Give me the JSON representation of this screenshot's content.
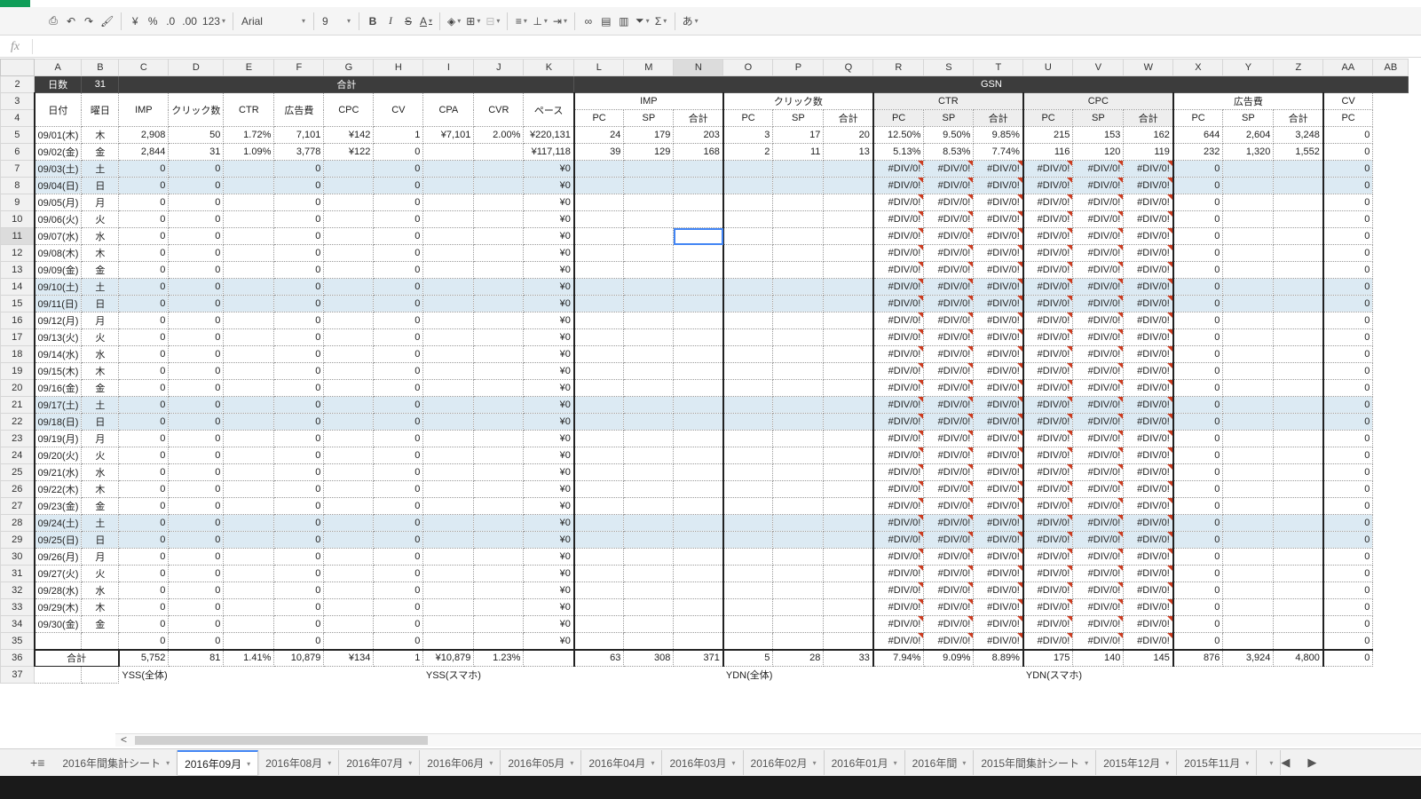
{
  "toolbar": {
    "currency_label": "¥",
    "percent_label": "%",
    "decimal_decrease_label": ".0",
    "decimal_increase_label": ".00",
    "more_formats_label": "123",
    "font_name": "Arial",
    "font_size": "9",
    "bold_label": "B",
    "italic_label": "I",
    "strike_label": "S",
    "text_color_label": "A",
    "input_tools_label": "あ"
  },
  "formula_bar": {
    "fx_label": "fx",
    "value": ""
  },
  "columns": [
    "A",
    "B",
    "C",
    "D",
    "E",
    "F",
    "G",
    "H",
    "I",
    "J",
    "K",
    "L",
    "M",
    "N",
    "O",
    "P",
    "Q",
    "R",
    "S",
    "T",
    "U",
    "V",
    "W",
    "X",
    "Y",
    "Z",
    "AA",
    "AB"
  ],
  "selected_column": "N",
  "selected_row": "11",
  "header": {
    "days_label": "日数",
    "days_value": "31",
    "total_group": "合計",
    "gsn_group": "GSN",
    "date_label": "日付",
    "weekday_label": "曜日",
    "total_cols": [
      "IMP",
      "クリック数",
      "CTR",
      "広告費",
      "CPC",
      "CV",
      "CPA",
      "CVR",
      "ペース"
    ],
    "gsn_groups": [
      "IMP",
      "クリック数",
      "CTR",
      "CPC",
      "広告費",
      "CV"
    ],
    "sub_cols": [
      "PC",
      "SP",
      "合計"
    ]
  },
  "rows": [
    {
      "r": "5",
      "date": "09/01(木)",
      "wd": "木",
      "we": false,
      "imp": "2,908",
      "clk": "50",
      "ctr": "1.72%",
      "cost": "7,101",
      "cpc": "¥142",
      "cv": "1",
      "cpa": "¥7,101",
      "cvr": "2.00%",
      "pace": "¥220,131",
      "g": [
        "24",
        "179",
        "203",
        "3",
        "17",
        "20",
        "12.50%",
        "9.50%",
        "9.85%",
        "215",
        "153",
        "162",
        "644",
        "2,604",
        "3,248",
        "0"
      ]
    },
    {
      "r": "6",
      "date": "09/02(金)",
      "wd": "金",
      "we": false,
      "imp": "2,844",
      "clk": "31",
      "ctr": "1.09%",
      "cost": "3,778",
      "cpc": "¥122",
      "cv": "0",
      "cpa": "",
      "cvr": "",
      "pace": "¥117,118",
      "g": [
        "39",
        "129",
        "168",
        "2",
        "11",
        "13",
        "5.13%",
        "8.53%",
        "7.74%",
        "116",
        "120",
        "119",
        "232",
        "1,320",
        "1,552",
        "0"
      ]
    },
    {
      "r": "7",
      "date": "09/03(土)",
      "wd": "土",
      "we": true
    },
    {
      "r": "8",
      "date": "09/04(日)",
      "wd": "日",
      "we": true
    },
    {
      "r": "9",
      "date": "09/05(月)",
      "wd": "月",
      "we": false
    },
    {
      "r": "10",
      "date": "09/06(火)",
      "wd": "火",
      "we": false
    },
    {
      "r": "11",
      "date": "09/07(水)",
      "wd": "水",
      "we": false
    },
    {
      "r": "12",
      "date": "09/08(木)",
      "wd": "木",
      "we": false
    },
    {
      "r": "13",
      "date": "09/09(金)",
      "wd": "金",
      "we": false
    },
    {
      "r": "14",
      "date": "09/10(土)",
      "wd": "土",
      "we": true
    },
    {
      "r": "15",
      "date": "09/11(日)",
      "wd": "日",
      "we": true
    },
    {
      "r": "16",
      "date": "09/12(月)",
      "wd": "月",
      "we": false
    },
    {
      "r": "17",
      "date": "09/13(火)",
      "wd": "火",
      "we": false
    },
    {
      "r": "18",
      "date": "09/14(水)",
      "wd": "水",
      "we": false
    },
    {
      "r": "19",
      "date": "09/15(木)",
      "wd": "木",
      "we": false
    },
    {
      "r": "20",
      "date": "09/16(金)",
      "wd": "金",
      "we": false
    },
    {
      "r": "21",
      "date": "09/17(土)",
      "wd": "土",
      "we": true
    },
    {
      "r": "22",
      "date": "09/18(日)",
      "wd": "日",
      "we": true
    },
    {
      "r": "23",
      "date": "09/19(月)",
      "wd": "月",
      "we": false
    },
    {
      "r": "24",
      "date": "09/20(火)",
      "wd": "火",
      "we": false
    },
    {
      "r": "25",
      "date": "09/21(水)",
      "wd": "水",
      "we": false
    },
    {
      "r": "26",
      "date": "09/22(木)",
      "wd": "木",
      "we": false
    },
    {
      "r": "27",
      "date": "09/23(金)",
      "wd": "金",
      "we": false
    },
    {
      "r": "28",
      "date": "09/24(土)",
      "wd": "土",
      "we": true
    },
    {
      "r": "29",
      "date": "09/25(日)",
      "wd": "日",
      "we": true
    },
    {
      "r": "30",
      "date": "09/26(月)",
      "wd": "月",
      "we": false
    },
    {
      "r": "31",
      "date": "09/27(火)",
      "wd": "火",
      "we": false
    },
    {
      "r": "32",
      "date": "09/28(水)",
      "wd": "水",
      "we": false
    },
    {
      "r": "33",
      "date": "09/29(木)",
      "wd": "木",
      "we": false
    },
    {
      "r": "34",
      "date": "09/30(金)",
      "wd": "金",
      "we": false
    },
    {
      "r": "35",
      "date": "",
      "wd": "",
      "we": false
    }
  ],
  "empty_row_values": {
    "zero": "0",
    "yen_zero": "¥0",
    "div_error": "#DIV/0!"
  },
  "total_row": {
    "r": "36",
    "label": "合計",
    "imp": "5,752",
    "clk": "81",
    "ctr": "1.41%",
    "cost": "10,879",
    "cpc": "¥134",
    "cv": "1",
    "cpa": "¥10,879",
    "cvr": "1.23%",
    "pace": "",
    "g": [
      "63",
      "308",
      "371",
      "5",
      "28",
      "33",
      "7.94%",
      "9.09%",
      "8.89%",
      "175",
      "140",
      "145",
      "876",
      "3,924",
      "4,800",
      "0"
    ]
  },
  "row37": {
    "r": "37",
    "labels": [
      "YSS(全体)",
      "YSS(スマホ)",
      "YDN(全体)",
      "YDN(スマホ)"
    ]
  },
  "sheet_tabs": [
    "2016年間集計シート",
    "2016年09月",
    "2016年08月",
    "2016年07月",
    "2016年06月",
    "2016年05月",
    "2016年04月",
    "2016年03月",
    "2016年02月",
    "2016年01月",
    "2016年間",
    "2015年間集計シート",
    "2015年12月",
    "2015年11月",
    ""
  ],
  "active_tab": 1,
  "tab_controls": {
    "add": "+",
    "list": "≡",
    "prev": "◀",
    "next": "▶"
  }
}
